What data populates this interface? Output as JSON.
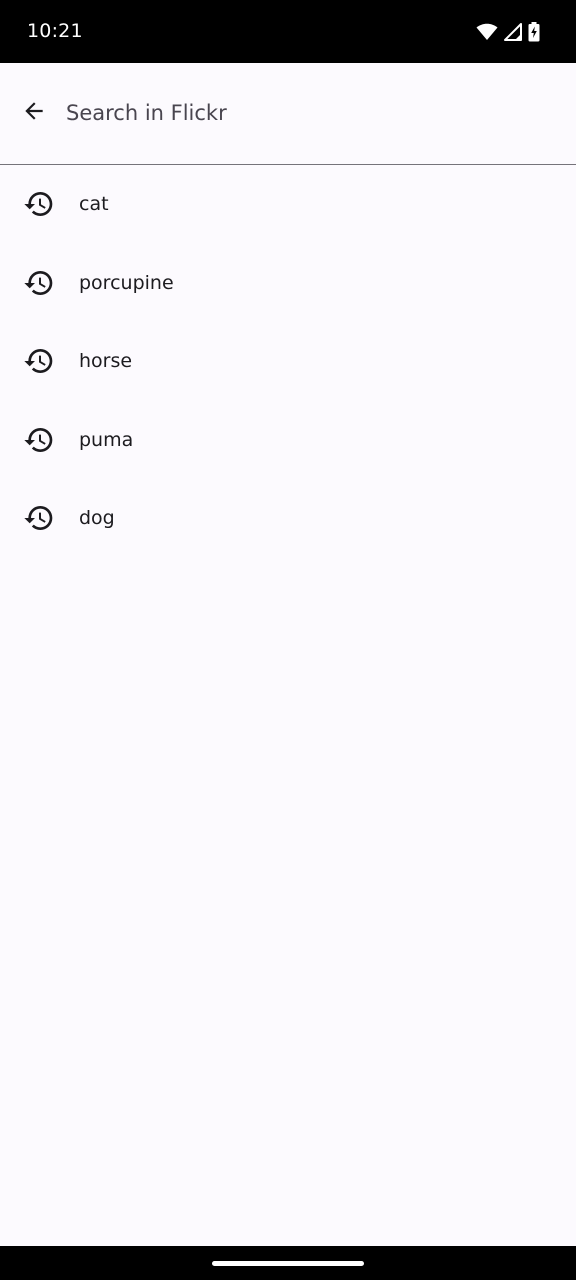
{
  "status_bar": {
    "time": "10:21",
    "icons": [
      "wifi-icon",
      "cellular-signal-icon",
      "battery-charging-icon"
    ]
  },
  "search": {
    "back_icon": "arrow-back-icon",
    "placeholder": "Search in Flickr",
    "value": ""
  },
  "history": {
    "icon": "history-icon",
    "items": [
      {
        "label": "cat"
      },
      {
        "label": "porcupine"
      },
      {
        "label": "horse"
      },
      {
        "label": "puma"
      },
      {
        "label": "dog"
      }
    ]
  },
  "colors": {
    "background": "#FCFAFE",
    "text": "#1C1B1F",
    "placeholder": "#49454F",
    "divider": "#75737A",
    "system_bars": "#000000"
  }
}
